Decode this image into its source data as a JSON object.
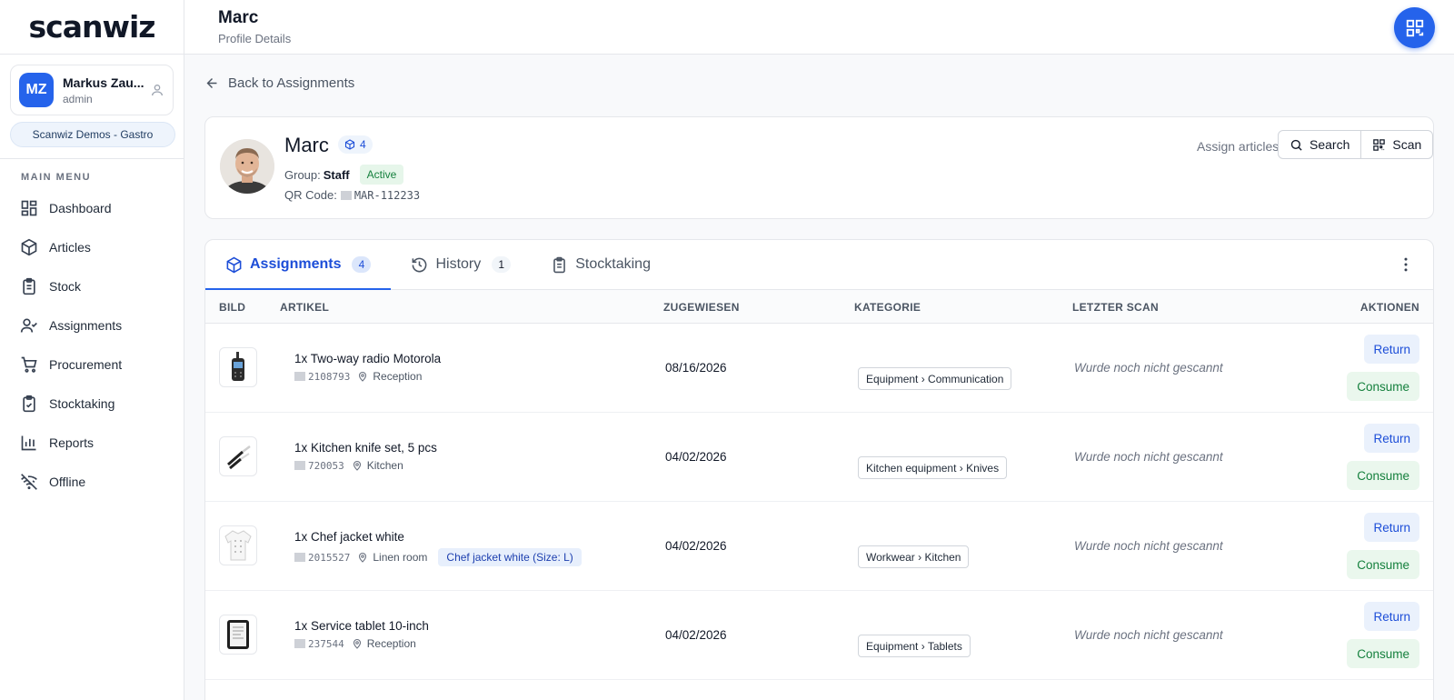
{
  "app": {
    "logo": "scanwiz"
  },
  "user": {
    "initials": "MZ",
    "name": "Markus Zau...",
    "role": "admin",
    "organization": "Scanwiz Demos - Gastro"
  },
  "menu": {
    "heading": "MAIN MENU",
    "items": [
      {
        "label": "Dashboard",
        "icon": "dashboard-icon"
      },
      {
        "label": "Articles",
        "icon": "cube-icon"
      },
      {
        "label": "Stock",
        "icon": "clipboard-icon"
      },
      {
        "label": "Assignments",
        "icon": "user-check-icon"
      },
      {
        "label": "Procurement",
        "icon": "cart-icon"
      },
      {
        "label": "Stocktaking",
        "icon": "clipboard-check-icon"
      },
      {
        "label": "Reports",
        "icon": "bar-chart-icon"
      },
      {
        "label": "Offline",
        "icon": "wifi-off-icon"
      }
    ]
  },
  "header": {
    "title": "Marc",
    "subtitle": "Profile Details"
  },
  "back_link": "Back to Assignments",
  "profile": {
    "name": "Marc",
    "badge_count": "4",
    "group_label": "Group:",
    "group": "Staff",
    "status": "Active",
    "qr_label": "QR Code:",
    "qr_code": "MAR-112233",
    "assign_label": "Assign articles",
    "search_label": "Search",
    "scan_label": "Scan"
  },
  "tabs": [
    {
      "label": "Assignments",
      "count": "4",
      "icon": "cube-icon",
      "active": true
    },
    {
      "label": "History",
      "count": "1",
      "icon": "history-icon",
      "active": false
    },
    {
      "label": "Stocktaking",
      "count": "",
      "icon": "clipboard-icon",
      "active": false
    }
  ],
  "table": {
    "columns": [
      "BILD",
      "ARTIKEL",
      "ZUGEWIESEN",
      "KATEGORIE",
      "LETZTER SCAN",
      "AKTIONEN"
    ],
    "rows": [
      {
        "qty": "1x",
        "title": "Two-way radio Motorola",
        "code": "2108793",
        "location": "Reception",
        "variant": "",
        "assigned": "08/16/2026",
        "category": "Equipment › Communication",
        "last_scan": "Wurde noch nicht gescannt",
        "thumb": "radio"
      },
      {
        "qty": "1x",
        "title": "Kitchen knife set, 5 pcs",
        "code": "720053",
        "location": "Kitchen",
        "variant": "",
        "assigned": "04/02/2026",
        "category": "Kitchen equipment › Knives",
        "last_scan": "Wurde noch nicht gescannt",
        "thumb": "knives"
      },
      {
        "qty": "1x",
        "title": "Chef jacket white",
        "code": "2015527",
        "location": "Linen room",
        "variant": "Chef jacket white (Size: L)",
        "assigned": "04/02/2026",
        "category": "Workwear › Kitchen",
        "last_scan": "Wurde noch nicht gescannt",
        "thumb": "jacket"
      },
      {
        "qty": "1x",
        "title": "Service tablet 10-inch",
        "code": "237544",
        "location": "Reception",
        "variant": "",
        "assigned": "04/02/2026",
        "category": "Equipment › Tablets",
        "last_scan": "Wurde noch nicht gescannt",
        "thumb": "tablet"
      }
    ],
    "return_label": "Return",
    "consume_label": "Consume"
  },
  "colors": {
    "accent": "#2563eb",
    "success": "#15803d"
  }
}
